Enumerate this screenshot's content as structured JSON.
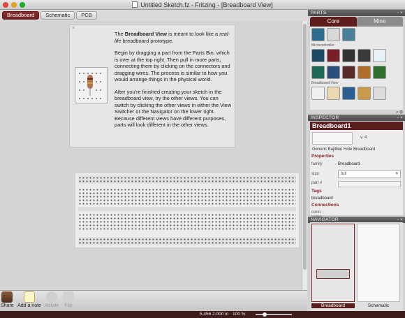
{
  "window": {
    "title": "Untitled Sketch.fz - Fritzing - [Breadboard View]"
  },
  "tabs": [
    "Breadboard",
    "Schematic",
    "PCB"
  ],
  "welcome": {
    "close_icon": "×",
    "p1_pre": "The ",
    "p1_bold": "Breadboard View",
    "p1_mid": " is meant to look like a ",
    "p1_em": "real-life",
    "p1_post": " breadboard prototype.",
    "p2": "Begin by dragging a part from the Parts Bin, which is over at the top right. Then pull in more parts, connecting them by clicking on the connectors and dragging wires. The process is similar to how you would arrange things in the physical world.",
    "p3": "After you're finished creating your sketch in the breadboard view, try the other views. You can switch by clicking the other views in either the View Switcher or the Navigator on the lower right. Because different views have different purposes, parts will look different in the other views."
  },
  "toolbar": {
    "share": "Share",
    "add_note": "Add a note",
    "rotate": "Rotate",
    "flip": "Flip"
  },
  "status": {
    "coords": "5.456 2.000 in",
    "zoom": "100 %"
  },
  "parts": {
    "header": "PARTS",
    "tabs": [
      "Core",
      "Mine"
    ],
    "bin_labels": [
      "Microcontroller",
      "Breadboard View"
    ]
  },
  "inspector": {
    "header": "INSPECTOR",
    "title": "Breadboard1",
    "version": "v. 4",
    "description": "Generic Bajillion Hole Breadboard",
    "properties_label": "Properties",
    "family_label": "family",
    "family_value": "Breadboard",
    "size_label": "size",
    "size_value": "full",
    "partnum_label": "part #",
    "tags_label": "Tags",
    "tags_value": "breadboard",
    "connections_label": "Connections",
    "conn_label": "conn.",
    "name_label": "name"
  },
  "navigator": {
    "header": "NAVIGATOR",
    "views": [
      "Breadboard",
      "Schematic"
    ]
  },
  "colors": {
    "accent": "#5a1e1e",
    "tab_active": "#7a2626"
  }
}
